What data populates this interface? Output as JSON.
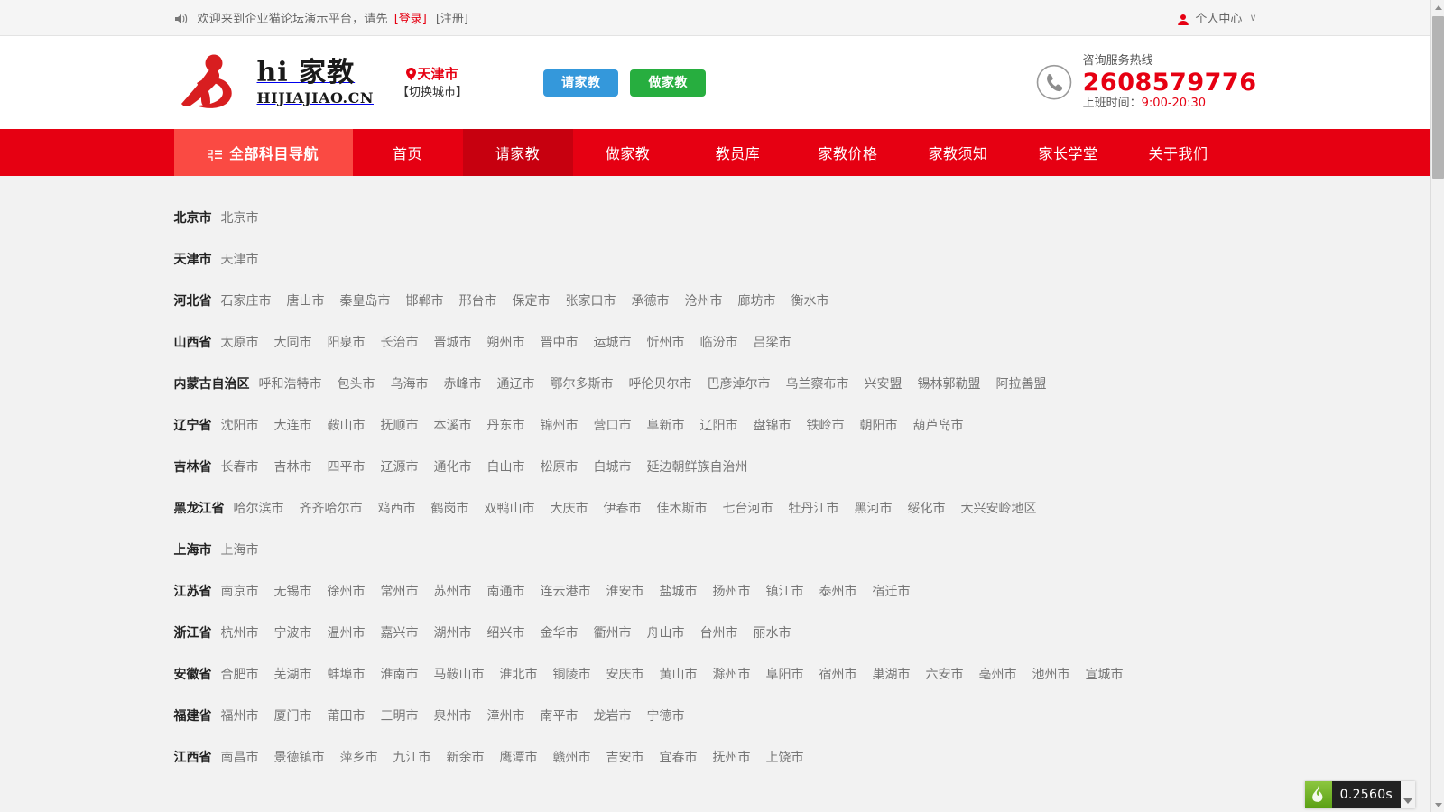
{
  "topbar": {
    "speaker_icon": "speaker-icon",
    "welcome": "欢迎来到企业猫论坛演示平台，请先",
    "login": "[登录]",
    "register": "[注册]",
    "user_icon": "user-icon",
    "user_center": "个人中心",
    "chevron": "∨"
  },
  "header": {
    "logo_title": "hi 家教",
    "logo_sub": "HIJIAJIAO.CN",
    "pin_icon": "location-pin-icon",
    "city_name": "天津市",
    "city_switch": "【切换城市】",
    "btn_request": "请家教",
    "btn_become": "做家教",
    "phone_icon": "phone-icon",
    "hotline_label": "咨询服务热线",
    "hotline_number": "2608579776",
    "hotline_hours_label": "上班时间：",
    "hotline_hours_value": "9:00-20:30"
  },
  "nav": {
    "all_icon": "grid-menu-icon",
    "all_label": "全部科目导航",
    "items": [
      {
        "label": "首页",
        "active": false
      },
      {
        "label": "请家教",
        "active": true
      },
      {
        "label": "做家教",
        "active": false
      },
      {
        "label": "教员库",
        "active": false
      },
      {
        "label": "家教价格",
        "active": false
      },
      {
        "label": "家教须知",
        "active": false
      },
      {
        "label": "家长学堂",
        "active": false
      },
      {
        "label": "关于我们",
        "active": false
      }
    ]
  },
  "provinces": [
    {
      "name": "北京市",
      "cities": [
        "北京市"
      ]
    },
    {
      "name": "天津市",
      "cities": [
        "天津市"
      ]
    },
    {
      "name": "河北省",
      "cities": [
        "石家庄市",
        "唐山市",
        "秦皇岛市",
        "邯郸市",
        "邢台市",
        "保定市",
        "张家口市",
        "承德市",
        "沧州市",
        "廊坊市",
        "衡水市"
      ]
    },
    {
      "name": "山西省",
      "cities": [
        "太原市",
        "大同市",
        "阳泉市",
        "长治市",
        "晋城市",
        "朔州市",
        "晋中市",
        "运城市",
        "忻州市",
        "临汾市",
        "吕梁市"
      ]
    },
    {
      "name": "内蒙古自治区",
      "cities": [
        "呼和浩特市",
        "包头市",
        "乌海市",
        "赤峰市",
        "通辽市",
        "鄂尔多斯市",
        "呼伦贝尔市",
        "巴彦淖尔市",
        "乌兰察布市",
        "兴安盟",
        "锡林郭勒盟",
        "阿拉善盟"
      ]
    },
    {
      "name": "辽宁省",
      "cities": [
        "沈阳市",
        "大连市",
        "鞍山市",
        "抚顺市",
        "本溪市",
        "丹东市",
        "锦州市",
        "营口市",
        "阜新市",
        "辽阳市",
        "盘锦市",
        "铁岭市",
        "朝阳市",
        "葫芦岛市"
      ]
    },
    {
      "name": "吉林省",
      "cities": [
        "长春市",
        "吉林市",
        "四平市",
        "辽源市",
        "通化市",
        "白山市",
        "松原市",
        "白城市",
        "延边朝鲜族自治州"
      ]
    },
    {
      "name": "黑龙江省",
      "cities": [
        "哈尔滨市",
        "齐齐哈尔市",
        "鸡西市",
        "鹤岗市",
        "双鸭山市",
        "大庆市",
        "伊春市",
        "佳木斯市",
        "七台河市",
        "牡丹江市",
        "黑河市",
        "绥化市",
        "大兴安岭地区"
      ]
    },
    {
      "name": "上海市",
      "cities": [
        "上海市"
      ]
    },
    {
      "name": "江苏省",
      "cities": [
        "南京市",
        "无锡市",
        "徐州市",
        "常州市",
        "苏州市",
        "南通市",
        "连云港市",
        "淮安市",
        "盐城市",
        "扬州市",
        "镇江市",
        "泰州市",
        "宿迁市"
      ]
    },
    {
      "name": "浙江省",
      "cities": [
        "杭州市",
        "宁波市",
        "温州市",
        "嘉兴市",
        "湖州市",
        "绍兴市",
        "金华市",
        "衢州市",
        "舟山市",
        "台州市",
        "丽水市"
      ]
    },
    {
      "name": "安徽省",
      "cities": [
        "合肥市",
        "芜湖市",
        "蚌埠市",
        "淮南市",
        "马鞍山市",
        "淮北市",
        "铜陵市",
        "安庆市",
        "黄山市",
        "滁州市",
        "阜阳市",
        "宿州市",
        "巢湖市",
        "六安市",
        "亳州市",
        "池州市",
        "宣城市"
      ]
    },
    {
      "name": "福建省",
      "cities": [
        "福州市",
        "厦门市",
        "莆田市",
        "三明市",
        "泉州市",
        "漳州市",
        "南平市",
        "龙岩市",
        "宁德市"
      ]
    },
    {
      "name": "江西省",
      "cities": [
        "南昌市",
        "景德镇市",
        "萍乡市",
        "九江市",
        "新余市",
        "鹰潭市",
        "赣州市",
        "吉安市",
        "宜春市",
        "抚州市",
        "上饶市"
      ]
    }
  ],
  "perf": {
    "icon": "green-flame-icon",
    "time": "0.2560s",
    "caret_icon": "caret-down-icon"
  },
  "scrollbar": {
    "up_icon": "scroll-up-arrow-icon",
    "down_icon": "scroll-down-arrow-icon",
    "thumb": "scrollbar-thumb"
  },
  "colors": {
    "brand_red": "#e60012",
    "nav_active": "#c7000f",
    "nav_all": "#fa4a43",
    "blue_button": "#3498db",
    "green_button": "#27ae3f",
    "page_bg": "#f2f2f2"
  }
}
